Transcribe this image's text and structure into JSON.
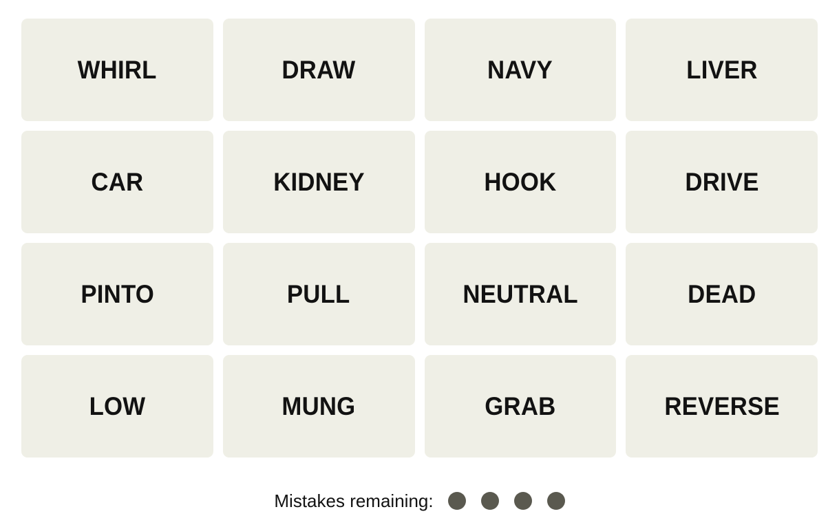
{
  "game": {
    "name": "Connections",
    "tile_background": "#EFEFE6",
    "page_background": "#FFFFFF",
    "text_color": "#121212",
    "dot_color": "#5A594F"
  },
  "grid": {
    "rows": 4,
    "columns": 4,
    "tiles": [
      {
        "word": "WHIRL",
        "row": 1,
        "col": 1,
        "selected": false
      },
      {
        "word": "DRAW",
        "row": 1,
        "col": 2,
        "selected": false
      },
      {
        "word": "NAVY",
        "row": 1,
        "col": 3,
        "selected": false
      },
      {
        "word": "LIVER",
        "row": 1,
        "col": 4,
        "selected": false
      },
      {
        "word": "CAR",
        "row": 2,
        "col": 1,
        "selected": false
      },
      {
        "word": "KIDNEY",
        "row": 2,
        "col": 2,
        "selected": false
      },
      {
        "word": "HOOK",
        "row": 2,
        "col": 3,
        "selected": false
      },
      {
        "word": "DRIVE",
        "row": 2,
        "col": 4,
        "selected": false
      },
      {
        "word": "PINTO",
        "row": 3,
        "col": 1,
        "selected": false
      },
      {
        "word": "PULL",
        "row": 3,
        "col": 2,
        "selected": false
      },
      {
        "word": "NEUTRAL",
        "row": 3,
        "col": 3,
        "selected": false
      },
      {
        "word": "DEAD",
        "row": 3,
        "col": 4,
        "selected": false
      },
      {
        "word": "LOW",
        "row": 4,
        "col": 1,
        "selected": false
      },
      {
        "word": "MUNG",
        "row": 4,
        "col": 2,
        "selected": false
      },
      {
        "word": "GRAB",
        "row": 4,
        "col": 3,
        "selected": false
      },
      {
        "word": "REVERSE",
        "row": 4,
        "col": 4,
        "selected": false
      }
    ]
  },
  "mistakes": {
    "label": "Mistakes remaining:",
    "remaining": 4,
    "dots": [
      1,
      2,
      3,
      4
    ]
  }
}
